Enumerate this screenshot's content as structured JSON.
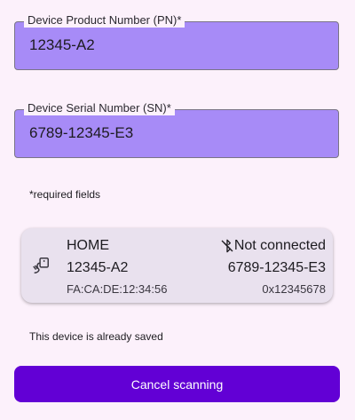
{
  "form": {
    "product_number": {
      "label": "Device Product Number (PN)*",
      "value": "12345-A2"
    },
    "serial_number": {
      "label": "Device Serial Number (SN)*",
      "value": "6789-12345-E3"
    },
    "required_note": "*required fields"
  },
  "device_card": {
    "name": "HOME",
    "product_number": "12345-A2",
    "mac_address": "FA:CA:DE:12:34:56",
    "status": "Not connected",
    "serial_number": "6789-12345-E3",
    "hex_id": "0x12345678",
    "device_icon": "device-plug-icon",
    "status_icon": "bluetooth-disabled-icon"
  },
  "saved_note": "This device is already saved",
  "cancel_button": {
    "label": "Cancel scanning"
  },
  "colors": {
    "background": "#fcf1fb",
    "field_fill": "#a78bf7",
    "card_fill": "#e9e1ee",
    "primary": "#6200d5"
  }
}
